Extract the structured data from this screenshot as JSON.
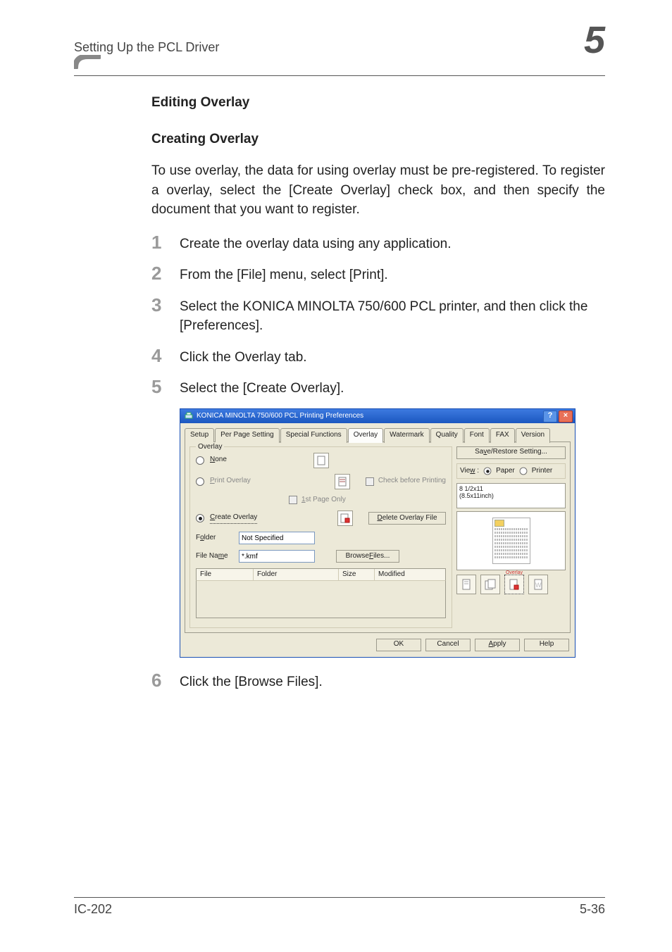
{
  "running_head": {
    "section_title": "Setting Up the PCL Driver",
    "chapter_number": "5"
  },
  "headings": {
    "editing_overlay": "Editing Overlay",
    "creating_overlay": "Creating Overlay"
  },
  "intro_paragraph": "To use overlay, the data for using overlay must be pre-registered. To register a overlay, select the [Create Overlay] check box, and then specify the document that you want to register.",
  "steps": {
    "s1": {
      "num": "1",
      "text": "Create the overlay data using any application."
    },
    "s2": {
      "num": "2",
      "text": "From the [File] menu, select [Print]."
    },
    "s3": {
      "num": "3",
      "text": "Select the KONICA MINOLTA 750/600 PCL printer, and then click the [Preferences]."
    },
    "s4": {
      "num": "4",
      "text": "Click the Overlay tab."
    },
    "s5": {
      "num": "5",
      "text": "Select the [Create Overlay]."
    },
    "s6": {
      "num": "6",
      "text": "Click the [Browse Files]."
    }
  },
  "dialog": {
    "title": "KONICA MINOLTA 750/600 PCL Printing Preferences",
    "tabs": {
      "setup": "Setup",
      "perpage": "Per Page Setting",
      "special": "Special Functions",
      "overlay": "Overlay",
      "watermark": "Watermark",
      "quality": "Quality",
      "font": "Font",
      "fax": "FAX",
      "version": "Version"
    },
    "group_label": "Overlay",
    "radios": {
      "none": {
        "label_pre": "N",
        "label_rest": "one",
        "checked": false
      },
      "print": {
        "label_pre": "P",
        "label_rest": "rint Overlay",
        "checked": false
      },
      "create": {
        "label_pre": "C",
        "label_rest": "reate Overlay",
        "checked": true
      }
    },
    "checks": {
      "check_before": "Check before Printing",
      "first_page": "1st Page Only"
    },
    "buttons": {
      "delete_file_pre": "D",
      "delete_file_rest": "elete Overlay File",
      "browse_pre": "Browse ",
      "browse_underline": "F",
      "browse_post": "iles...",
      "save_restore": "Save/Restore Setting...",
      "save_restore_underline": "v"
    },
    "fields": {
      "folder_label_pre": "F",
      "folder_label_underline": "o",
      "folder_label_post": "lder",
      "folder_value": "Not Specified",
      "filename_label": "File Name",
      "filename_mne": "m",
      "filename_value": "*.kmf"
    },
    "list_headers": {
      "file": "File",
      "folder": "Folder",
      "size": "Size",
      "modified": "Modified"
    },
    "right": {
      "view_label_pre": "Vie",
      "view_label_underline": "w",
      "view_label_post": " :",
      "view_paper": "Paper",
      "view_printer": "Printer",
      "paper_line1": "8 1/2x11",
      "paper_line2": "(8.5x11inch)",
      "overlay_tag": "Overlay"
    },
    "footer": {
      "ok": "OK",
      "cancel": "Cancel",
      "apply_pre": "A",
      "apply_rest": "pply",
      "help": "Help"
    }
  },
  "page_footer": {
    "left": "IC-202",
    "right": "5-36"
  }
}
